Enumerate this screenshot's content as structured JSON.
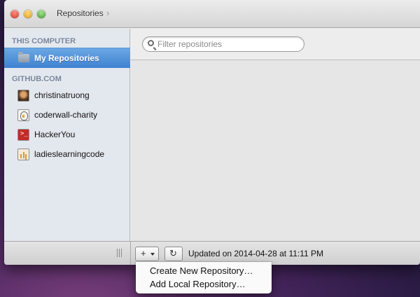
{
  "titlebar": {
    "breadcrumb": "Repositories"
  },
  "sidebar": {
    "this_computer_header": "THIS COMPUTER",
    "my_repositories": "My Repositories",
    "github_header": "GITHUB.COM",
    "accounts": [
      {
        "label": "christinatruong",
        "icon": "user-avatar-icon"
      },
      {
        "label": "coderwall-charity",
        "icon": "org-avatar-icon"
      },
      {
        "label": "HackerYou",
        "icon": "terminal-avatar-icon"
      },
      {
        "label": "ladieslearningcode",
        "icon": "org-avatar-icon"
      }
    ]
  },
  "search": {
    "placeholder": "Filter repositories",
    "value": ""
  },
  "bottom_bar": {
    "add_button_glyph": "+",
    "refresh_glyph": "↻",
    "status": "Updated on 2014-04-28 at 11:11 PM"
  },
  "add_menu": {
    "items": [
      "Create New Repository…",
      "Add Local Repository…"
    ]
  },
  "colors": {
    "selection": "#3f82d1",
    "sidebar_bg": "#e3e8ee",
    "section_header": "#76859a"
  }
}
